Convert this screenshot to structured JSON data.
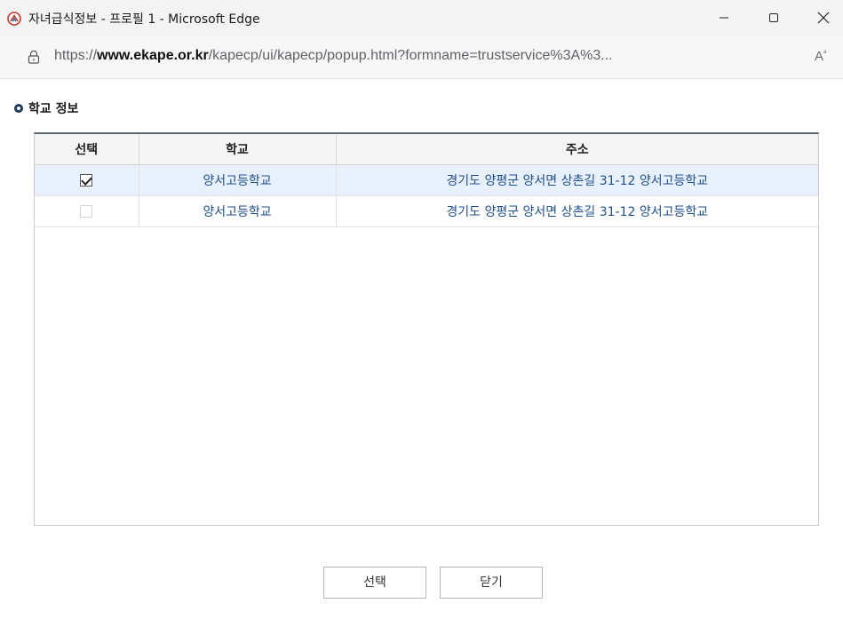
{
  "window": {
    "title": "자녀급식정보 - 프로필 1 - Microsoft Edge",
    "icons": {
      "app": "kape-logo-icon",
      "minimize": "minimize-icon",
      "maximize": "maximize-icon",
      "close": "close-icon"
    }
  },
  "address_bar": {
    "url_prefix": "https://",
    "url_host": "www.ekape.or.kr",
    "url_path": "/kapecp/ui/kapecp/popup.html?formname=trustservice%3A%3...",
    "read_aloud_label": "A",
    "icons": {
      "lock": "lock-icon",
      "read_aloud": "read-aloud-icon"
    }
  },
  "section": {
    "title": "학교 정보"
  },
  "table": {
    "columns": [
      "선택",
      "학교",
      "주소"
    ],
    "rows": [
      {
        "checked": true,
        "school": "양서고등학교",
        "address": "경기도 양평군 양서면 상촌길 31-12 양서고등학교"
      },
      {
        "checked": false,
        "school": "양서고등학교",
        "address": "경기도 양평군 양서면 상촌길 31-12 양서고등학교"
      }
    ]
  },
  "buttons": {
    "select": "선택",
    "close": "닫기"
  }
}
